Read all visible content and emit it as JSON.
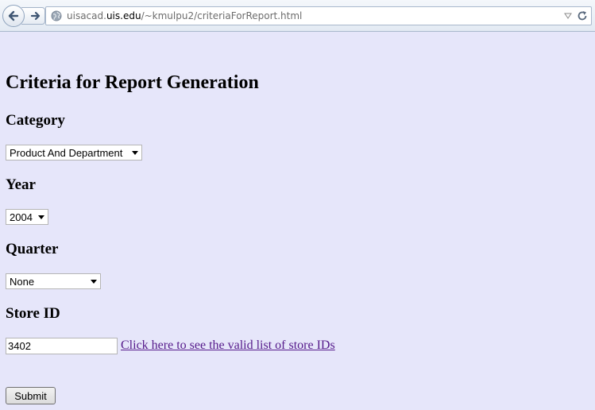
{
  "browser": {
    "url_prefix": "uisacad.",
    "url_domain": "uis.edu",
    "url_path": "/~kmulpu2/criteriaForReport.html"
  },
  "page": {
    "title": "Criteria for Report Generation"
  },
  "form": {
    "category": {
      "label": "Category",
      "selected": "Product And Department"
    },
    "year": {
      "label": "Year",
      "selected": "2004"
    },
    "quarter": {
      "label": "Quarter",
      "selected": "None"
    },
    "store_id": {
      "label": "Store ID",
      "value": "3402",
      "link_text": "Click here to see the valid list of store IDs"
    },
    "submit_label": "Submit"
  },
  "colors": {
    "page_background": "#e6e6fa",
    "link_visited": "#551a8b"
  },
  "icons": [
    "back-arrow-icon",
    "forward-arrow-icon",
    "globe-icon",
    "bookmark-dropdown-icon",
    "reload-icon",
    "select-dropdown-icon"
  ]
}
